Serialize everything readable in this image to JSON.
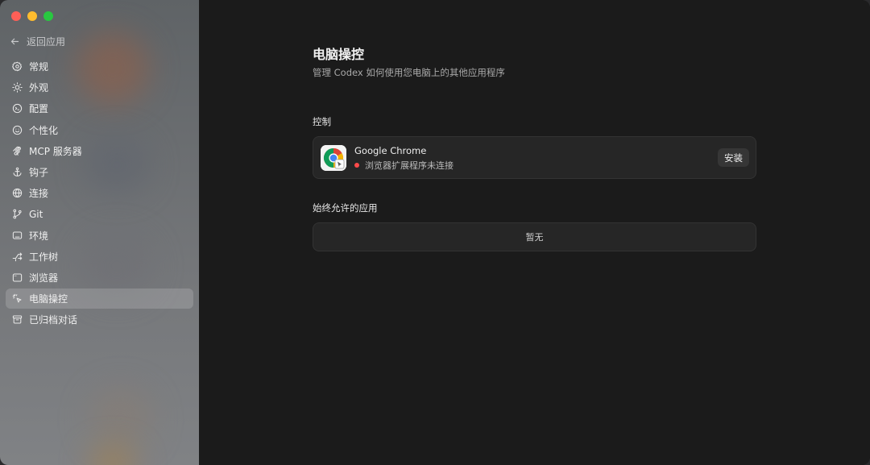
{
  "sidebar": {
    "back_label": "返回应用",
    "items": [
      {
        "label": "常规",
        "icon": "gear-icon"
      },
      {
        "label": "外观",
        "icon": "sun-icon"
      },
      {
        "label": "配置",
        "icon": "terminal-icon"
      },
      {
        "label": "个性化",
        "icon": "smile-icon"
      },
      {
        "label": "MCP 服务器",
        "icon": "mcp-icon"
      },
      {
        "label": "钩子",
        "icon": "anchor-icon"
      },
      {
        "label": "连接",
        "icon": "globe-icon"
      },
      {
        "label": "Git",
        "icon": "git-branch-icon"
      },
      {
        "label": "环境",
        "icon": "monitor-icon"
      },
      {
        "label": "工作树",
        "icon": "worktree-icon"
      },
      {
        "label": "浏览器",
        "icon": "browser-icon"
      },
      {
        "label": "电脑操控",
        "icon": "pointer-icon",
        "active": true
      },
      {
        "label": "已归档对话",
        "icon": "archive-icon"
      }
    ]
  },
  "main": {
    "title": "电脑操控",
    "subtitle": "管理 Codex 如何使用您电脑上的其他应用程序",
    "control_section": {
      "label": "控制",
      "app": {
        "name": "Google Chrome",
        "status": "浏览器扩展程序未连接",
        "status_color": "#ff4a4a",
        "install_label": "安装"
      }
    },
    "allowed_section": {
      "label": "始终允许的应用",
      "empty_text": "暂无"
    }
  }
}
